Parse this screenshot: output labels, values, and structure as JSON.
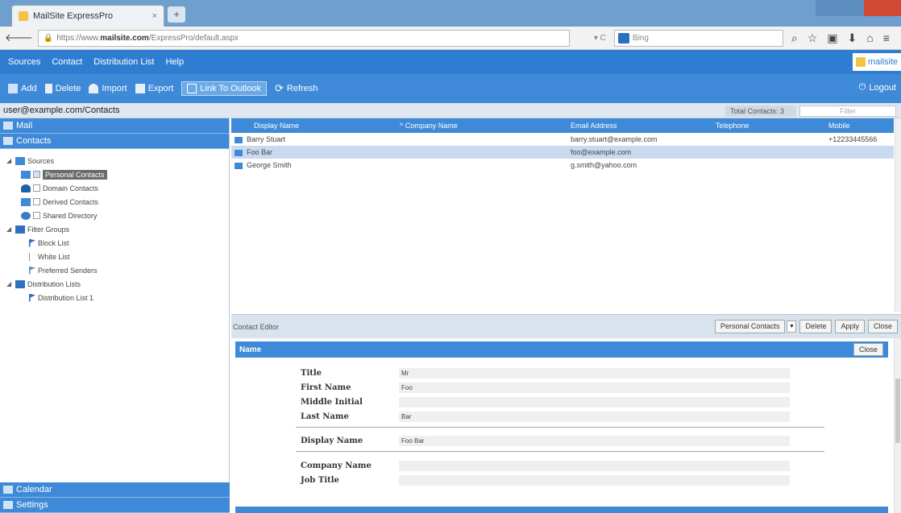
{
  "browser": {
    "tab_title": "MailSite ExpressPro",
    "tab_close": "×",
    "new_tab": "+",
    "url_prefix": "https://www.",
    "url_domain": "mailsite.com",
    "url_path": "/ExpressPro/default.aspx",
    "reload": "▾ C",
    "search_placeholder": "Bing"
  },
  "app_menu": {
    "items": [
      "Sources",
      "Contact",
      "Distribution List",
      "Help"
    ],
    "logo": "mailsite"
  },
  "toolbar": {
    "add": "Add",
    "delete": "Delete",
    "import": "Import",
    "export": "Export",
    "link_outlook": "Link To Outlook",
    "refresh": "Refresh",
    "logout": "Logout"
  },
  "pathbar": {
    "path": "user@example.com/Contacts",
    "total_label": "Total Contacts: 3",
    "filter_placeholder": "Filter"
  },
  "sidebar": {
    "mail": "Mail",
    "contacts": "Contacts",
    "tree": {
      "sources": "Sources",
      "personal": "Personal Contacts",
      "domain": "Domain Contacts",
      "derived": "Derived Contacts",
      "shared": "Shared Directory",
      "filter_groups": "Filter Groups",
      "block": "Block List",
      "white": "White List",
      "preferred": "Preferred Senders",
      "dist_lists": "Distribution Lists",
      "dist_list_1": "Distribution List 1"
    },
    "calendar": "Calendar",
    "settings": "Settings"
  },
  "grid": {
    "headers": [
      "Display Name",
      "Company Name",
      "Email Address",
      "Telephone",
      "Mobile"
    ],
    "rows": [
      {
        "name": "Barry Stuart",
        "company": "",
        "email": "barry.stuart@example.com",
        "phone": "",
        "mobile": "+12233445566"
      },
      {
        "name": "Foo Bar",
        "company": "",
        "email": "foo@example.com",
        "phone": "",
        "mobile": ""
      },
      {
        "name": "George Smith",
        "company": "",
        "email": "g.smith@yahoo.com",
        "phone": "",
        "mobile": ""
      }
    ]
  },
  "editor": {
    "title": "Contact Editor",
    "source_select": "Personal Contacts",
    "delete": "Delete",
    "apply": "Apply",
    "close": "Close",
    "section_name": "Name",
    "section_close": "Close",
    "fields": {
      "title_label": "Title",
      "title_value": "Mr",
      "first_label": "First Name",
      "first_value": "Foo",
      "middle_label": "Middle Initial",
      "middle_value": "",
      "last_label": "Last Name",
      "last_value": "Bar",
      "display_label": "Display Name",
      "display_value": "Foo Bar",
      "company_label": "Company Name",
      "company_value": "",
      "job_label": "Job Title",
      "job_value": ""
    }
  }
}
